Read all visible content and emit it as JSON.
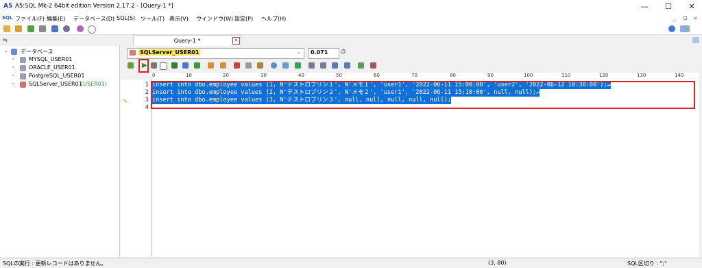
{
  "window": {
    "title": "A5:SQL Mk-2 64bit edition Version 2.17.2 - [Query-1 *]",
    "app_icon": "A5",
    "minimize": "—",
    "maximize": "☐",
    "close": "✕"
  },
  "menu": {
    "logo": "SQL",
    "items": [
      "ファイル(F)",
      "編集(E)",
      "データベース(D)",
      "SQL(S)",
      "ツール(T)",
      "表示(V)",
      "ウインドウ(W)",
      "設定(P)",
      "ヘルプ(H)"
    ],
    "mdi_controls": [
      "_",
      "⊡",
      "×"
    ]
  },
  "tab": {
    "label": "Query-1 *",
    "close": "✕"
  },
  "tree": {
    "root": "データベース",
    "items": [
      {
        "label": "MYSQL_USER01",
        "user": ""
      },
      {
        "label": "ORACLE_USER01",
        "user": ""
      },
      {
        "label": "PostgreSQL_USER01",
        "user": ""
      },
      {
        "label": "SQLServer_USER01",
        "user": "(USER01)"
      }
    ]
  },
  "connection": {
    "selected": "SQLServer_USER01",
    "elapsed": "0.071"
  },
  "ruler": [
    "0",
    "10",
    "20",
    "30",
    "40",
    "50",
    "60",
    "70",
    "80",
    "90",
    "100",
    "110",
    "120",
    "130",
    "140"
  ],
  "editor": {
    "line_numbers": [
      "1",
      "2",
      "3",
      "4"
    ],
    "lines": [
      "insert into dbo.employee values (1, N'テストロブリン１', N'メモ１', 'user1', '2022-06-11 15:00:00', 'user2', '2022-06-12 10:30:00');↵",
      "insert into dbo.employee values (2, N'テストロブリン２', N'メモ２', 'user1', '2022-06-11 15:10:00', null, null);↵",
      "insert into dbo.employee values (3, N'テストロブリン３', null, null, null, null, null);",
      ""
    ]
  },
  "status": {
    "message": "SQLの実行 : 更新レコードはありません。",
    "position": "(3, 80)",
    "delimiter": "SQL区切り : \";\""
  },
  "colors": {
    "selection": "#1070d8",
    "highlight_box": "#e01c1c",
    "connection_bg": "#ffe44d"
  }
}
